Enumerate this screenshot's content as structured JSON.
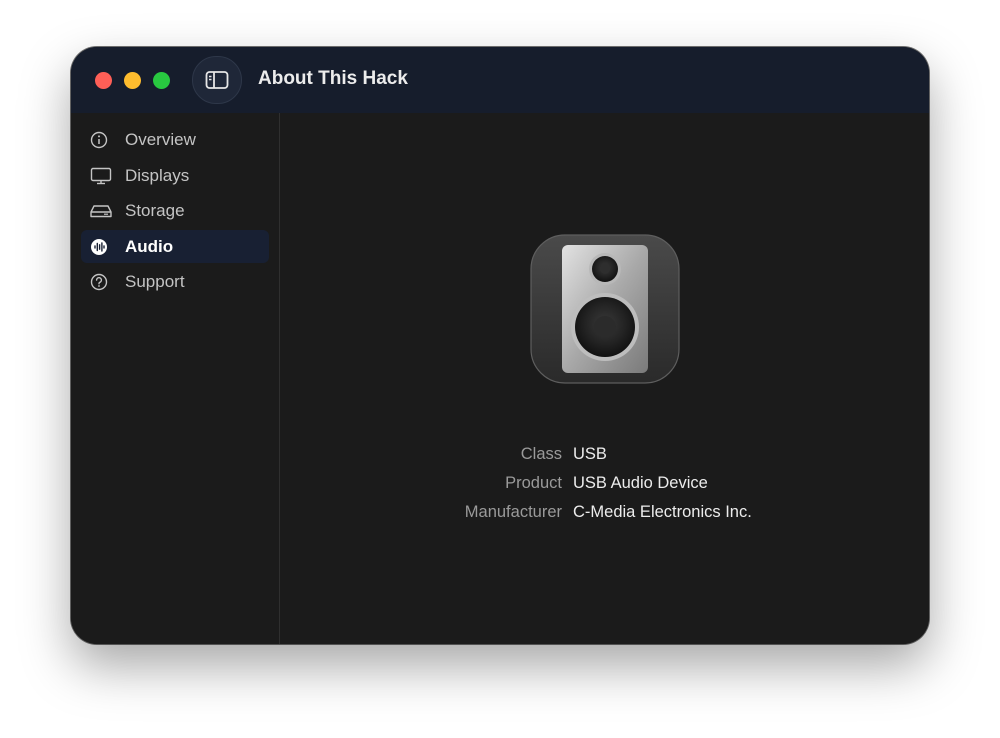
{
  "window": {
    "title": "About This Hack",
    "controls": [
      "close",
      "minimize",
      "maximize"
    ],
    "sidebar_toggle_icon": "sidebar-toggle-icon"
  },
  "sidebar": {
    "items": [
      {
        "label": "Overview",
        "icon": "info-circle-icon",
        "active": false
      },
      {
        "label": "Displays",
        "icon": "display-icon",
        "active": false
      },
      {
        "label": "Storage",
        "icon": "drive-icon",
        "active": false
      },
      {
        "label": "Audio",
        "icon": "waveform-icon",
        "active": true
      },
      {
        "label": "Support",
        "icon": "question-circle-icon",
        "active": false
      }
    ]
  },
  "main": {
    "device_icon": "speaker-icon",
    "details": [
      {
        "label": "Class",
        "value": "USB"
      },
      {
        "label": "Product",
        "value": "USB Audio Device"
      },
      {
        "label": "Manufacturer",
        "value": "C-Media Electronics Inc."
      }
    ]
  },
  "colors": {
    "active_item_bg": "#182033",
    "titlebar_bg": "#161d2c",
    "window_bg": "#1b1b1b",
    "close": "#fe5f57",
    "minimize": "#febc2e",
    "maximize": "#28c840"
  }
}
